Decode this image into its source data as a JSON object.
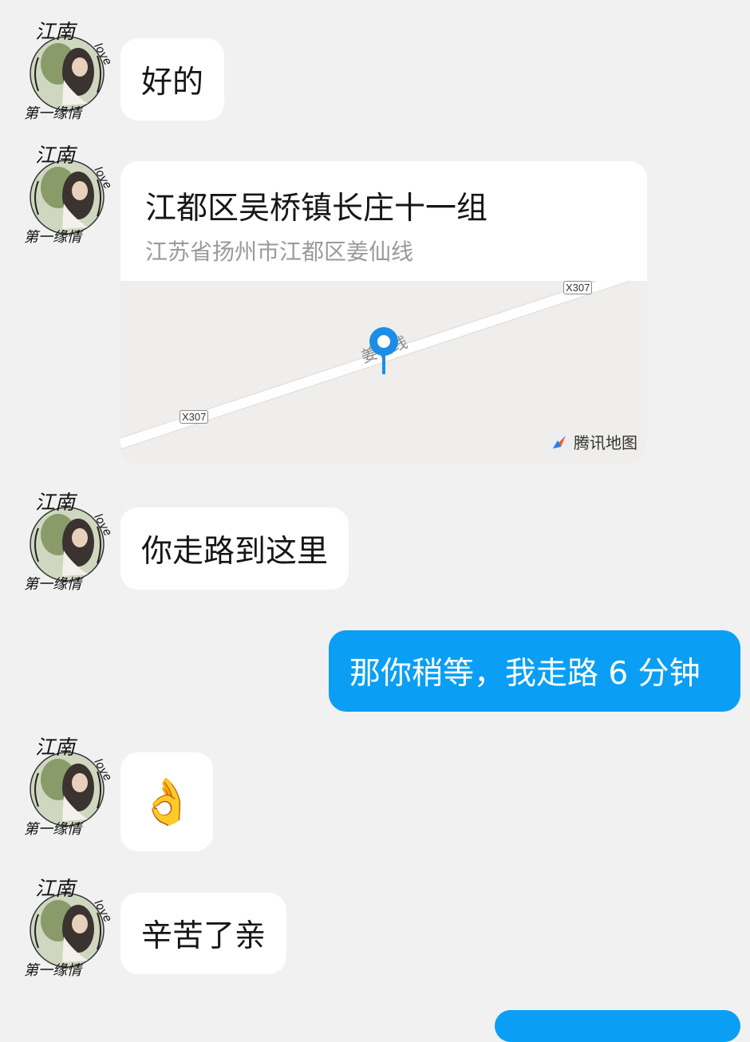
{
  "messages": [
    {
      "type": "incoming",
      "text": "好的"
    },
    {
      "type": "location",
      "title": "江都区吴桥镇长庄十一组",
      "address": "江苏省扬州市江都区姜仙线",
      "road_tag_top": "X307",
      "road_tag_bottom": "X307",
      "road_name": "姜仙线",
      "map_brand": "腾讯地图"
    },
    {
      "type": "incoming",
      "text": "你走路到这里"
    },
    {
      "type": "outgoing",
      "text": "那你稍等，我走路 6 分钟"
    },
    {
      "type": "incoming",
      "text": "👌"
    },
    {
      "type": "incoming",
      "text": "辛苦了亲"
    }
  ],
  "avatar": {
    "text_top": "江南",
    "text_bottom": "第一缘情",
    "text_side": "love"
  },
  "colors": {
    "background": "#f1f1f1",
    "outgoing_bubble": "#0a9ff5",
    "incoming_bubble": "#ffffff",
    "pin": "#1a8ee6"
  }
}
